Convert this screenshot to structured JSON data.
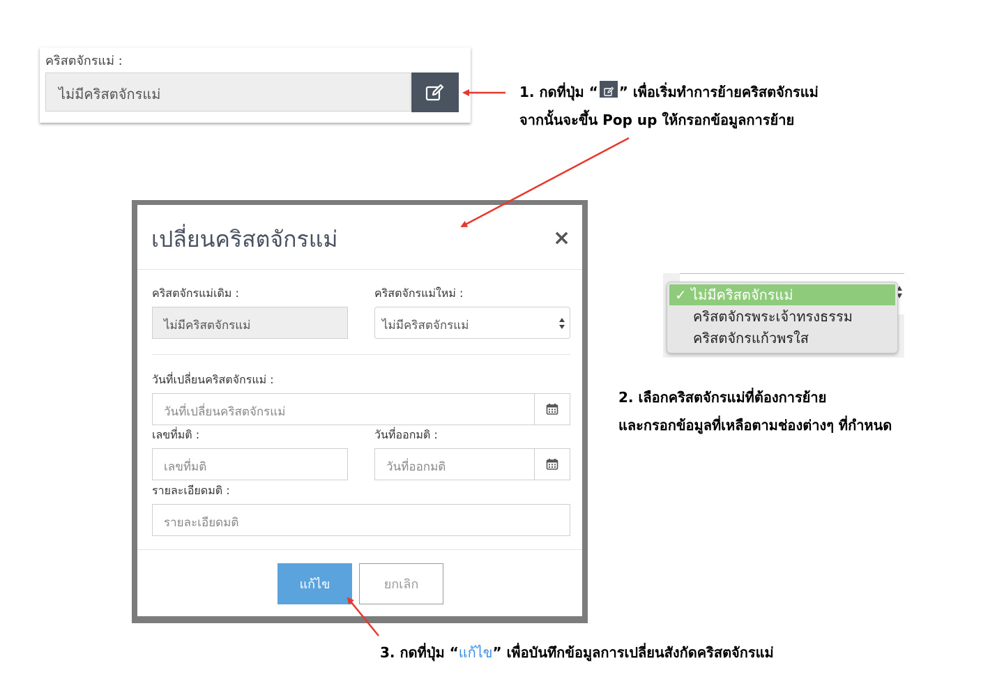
{
  "field_card": {
    "label": "คริสตจักรแม่ :",
    "value": "ไม่มีคริสตจักรแม่",
    "edit_icon": "edit-icon"
  },
  "instructions": {
    "step1_line1_pre": "1. กดที่ปุ่ม “",
    "step1_line1_post": "” เพื่อเริ่มทำการย้ายคริสตจักรแม่",
    "step1_line2": "จากนั้นจะขึ้น Pop up ให้กรอกข้อมูลการย้าย",
    "step2_line1": "2. เลือกคริสตจักรแม่ที่ต้องการย้าย",
    "step2_line2": "และกรอกข้อมูลที่เหลือตามช่องต่างๆ ที่กำหนด",
    "step3_pre": "3. กดที่ปุ่ม “",
    "step3_highlight": "แก้ไข",
    "step3_post": "” เพื่อบันทึกข้อมูลการเปลี่ยนสังกัดคริสตจักรแม่"
  },
  "modal": {
    "title": "เปลี่ยนคริสตจักรแม่",
    "close": "×",
    "old_church_label": "คริสตจักรแม่เดิม :",
    "old_church_value": "ไม่มีคริสตจักรแม่",
    "new_church_label": "คริสตจักรแม่ใหม่ :",
    "new_church_value": "ไม่มีคริสตจักรแม่",
    "change_date_label": "วันที่เปลี่ยนคริสตจักรแม่ :",
    "change_date_placeholder": "วันที่เปลี่ยนคริสตจักรแม่",
    "resolution_no_label": "เลขที่มติ :",
    "resolution_no_placeholder": "เลขที่มติ",
    "issue_date_label": "วันที่ออกมติ :",
    "issue_date_placeholder": "วันที่ออกมติ",
    "details_label": "รายละเอียดมติ :",
    "details_placeholder": "รายละเอียดมติ",
    "save_button": "แก้ไข",
    "cancel_button": "ยกเลิก"
  },
  "dropdown": {
    "options": [
      {
        "label": "ไม่มีคริสตจักรแม่",
        "selected": true
      },
      {
        "label": "คริสตจักรพระเจ้าทรงธรรม",
        "selected": false
      },
      {
        "label": "คริสตจักรแก้วพรใส",
        "selected": false
      }
    ],
    "check_mark": "✓",
    "selected_color": "#8ecb7a"
  },
  "colors": {
    "edit_button": "#4a5360",
    "save_button": "#5aa3dc",
    "arrow": "#e8372c",
    "highlight_text": "#3a8ee6"
  }
}
